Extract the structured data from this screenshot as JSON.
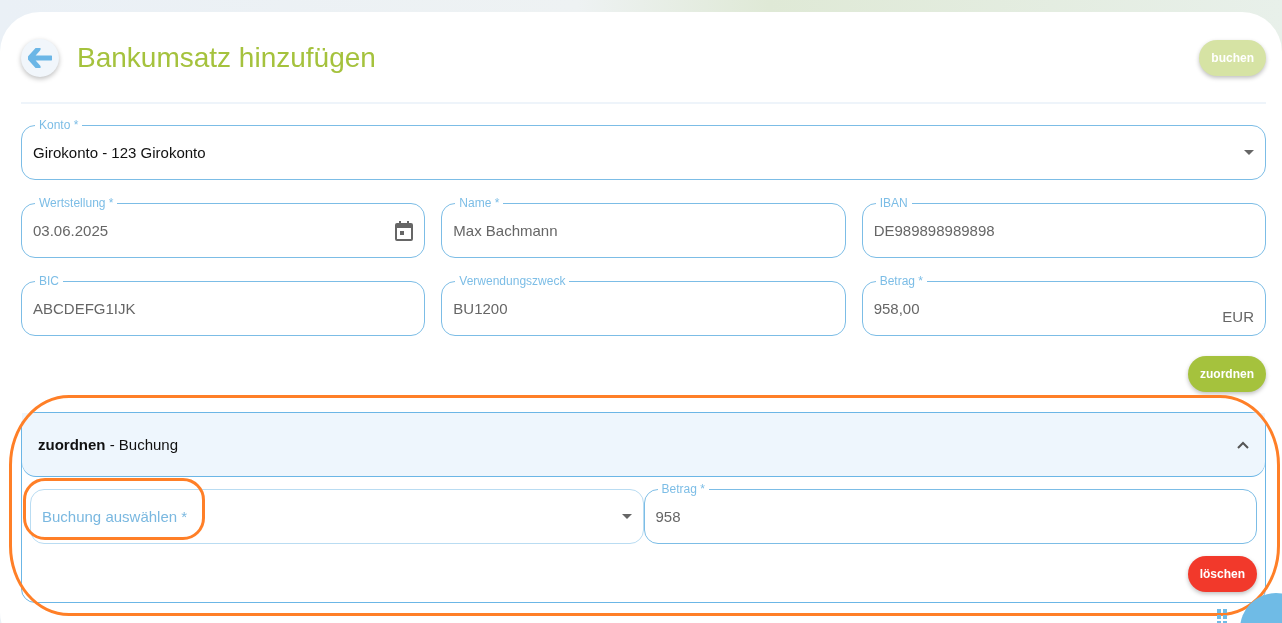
{
  "header": {
    "title": "Bankumsatz hinzufügen",
    "action": {
      "label": "buchen",
      "disabled": true
    }
  },
  "fields": [
    {
      "kind": "select",
      "label": "Konto *",
      "value": "Girokonto - 123 Girokonto",
      "wide": true
    },
    {
      "kind": "date",
      "label": "Wertstellung *",
      "value": "03.06.2025"
    },
    {
      "kind": "text",
      "label": "Name *",
      "value": "Max Bachmann"
    },
    {
      "kind": "text",
      "label": "IBAN",
      "value": "DE989898989898"
    },
    {
      "kind": "text",
      "label": "BIC",
      "value": "ABCDEFG1IJK"
    },
    {
      "kind": "text",
      "label": "Verwendungszweck",
      "value": "BU1200"
    },
    {
      "kind": "amount",
      "label": "Betrag *",
      "value": "958,00",
      "suffix": "EUR"
    }
  ],
  "assign_button": {
    "label": "zuordnen",
    "disabled": false
  },
  "assignment": {
    "title": "**zuordnen** - Buchung",
    "expanded": true,
    "highlighted": true,
    "booking": {
      "placeholder": "Buchung auswählen *",
      "highlighted": true
    },
    "amount": {
      "label": "Betrag *",
      "value": "958"
    },
    "delete_button": {
      "label": "löschen"
    }
  }
}
